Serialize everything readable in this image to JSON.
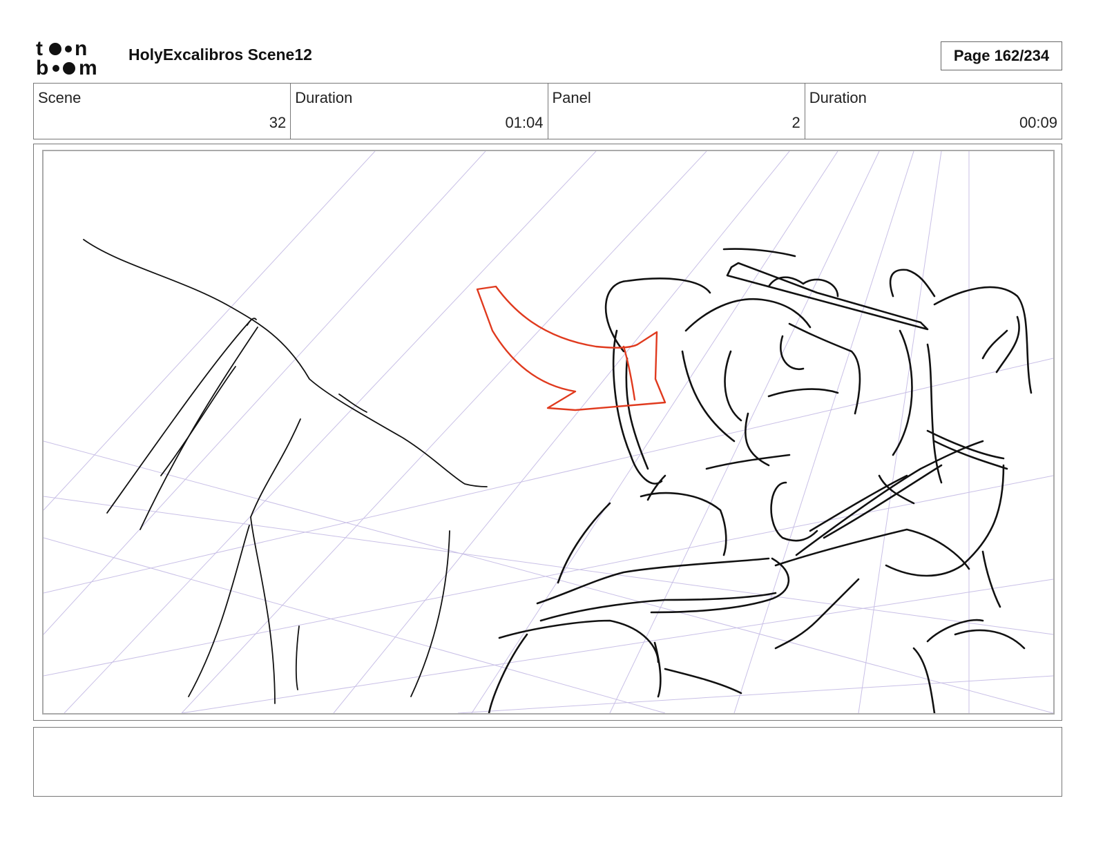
{
  "header": {
    "logo_text": "toon boom",
    "project_title": "HolyExcalibros Scene12",
    "page_label": "Page 162/234"
  },
  "info": [
    {
      "label": "Scene",
      "value": "32"
    },
    {
      "label": "Duration",
      "value": "01:04"
    },
    {
      "label": "Panel",
      "value": "2"
    },
    {
      "label": "Duration",
      "value": "00:09"
    }
  ],
  "panel": {
    "sketch_ink_color": "#111111",
    "arrow_color": "#e03a1e",
    "guide_color": "#c8bfe6"
  },
  "notes": {
    "text": ""
  }
}
